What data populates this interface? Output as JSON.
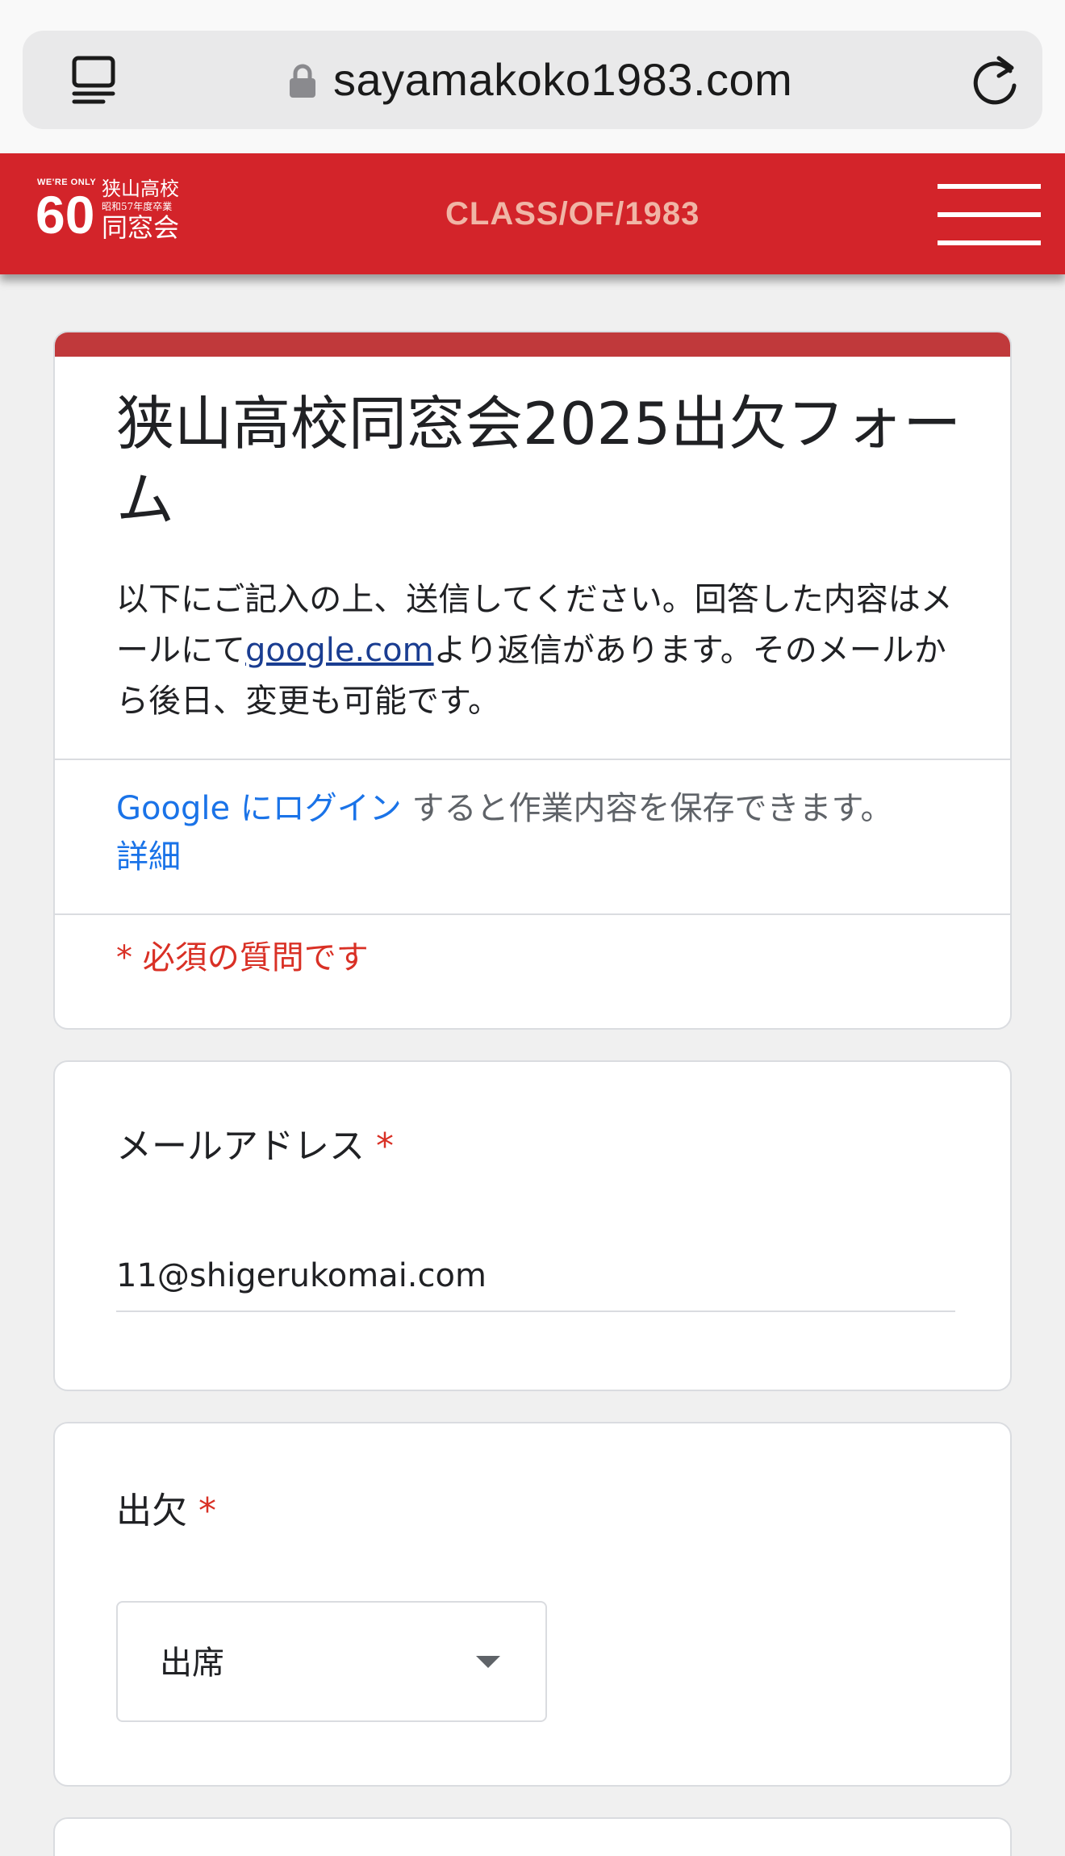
{
  "browser": {
    "url": "sayamakoko1983.com",
    "icons": {
      "tabs": "tabs-icon",
      "lock": "lock-icon",
      "reload": "reload-icon"
    }
  },
  "header": {
    "logo": {
      "small": "WE'RE ONLY",
      "number": "60",
      "line1": "狭山高校",
      "line2": "昭和57年度卒業",
      "line3": "同窓会"
    },
    "class_text": "CLASS/OF/1983",
    "menu_icon": "hamburger-menu-icon",
    "brand_color": "#d3242a"
  },
  "form": {
    "title": "狭山高校同窓会2025出欠フォーム",
    "description_before": "以下にご記入の上、送信してください。回答した内容はメールにて",
    "description_link": "google.com",
    "description_after": "より返信があります。そのメールから後日、変更も可能です。",
    "login_link": "Google にログイン",
    "login_text": "すると作業内容を保存できます。",
    "details_link": "詳細",
    "required_note": "* 必須の質問です",
    "accent_color": "#c0393b"
  },
  "questions": {
    "email": {
      "label": "メールアドレス",
      "required_mark": "*",
      "value": "11@shigerukomai.com"
    },
    "attendance": {
      "label": "出欠",
      "required_mark": "*",
      "selected": "出席"
    }
  }
}
